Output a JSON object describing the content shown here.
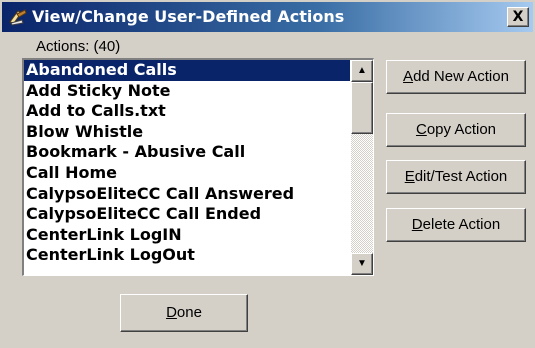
{
  "window": {
    "title": "View/Change User-Defined Actions",
    "close_label": "X"
  },
  "actions_label": "Actions: (40)",
  "actions": [
    "Abandoned Calls",
    "Add Sticky Note",
    "Add to Calls.txt",
    "Blow Whistle",
    "Bookmark - Abusive Call",
    "Call Home",
    "CalypsoEliteCC Call Answered",
    "CalypsoEliteCC Call Ended",
    "CenterLink LogIN",
    "CenterLink LogOut"
  ],
  "selected_index": 0,
  "buttons": {
    "add_new": {
      "mnemonic": "A",
      "rest": "dd New Action"
    },
    "copy": {
      "mnemonic": "C",
      "rest": "opy Action"
    },
    "edit_test": {
      "mnemonic": "E",
      "rest": "dit/Test Action"
    },
    "delete": {
      "mnemonic": "D",
      "rest": "elete Action"
    },
    "done": {
      "mnemonic": "D",
      "rest": "one"
    }
  },
  "icons": {
    "title": "app-icon",
    "close": "close-icon",
    "scroll_up": "scroll-up-icon",
    "scroll_down": "scroll-down-icon"
  },
  "colors": {
    "titlebar_start": "#0a246a",
    "titlebar_end": "#a6caf0",
    "selection": "#0a246a",
    "face": "#d4d0c8"
  }
}
